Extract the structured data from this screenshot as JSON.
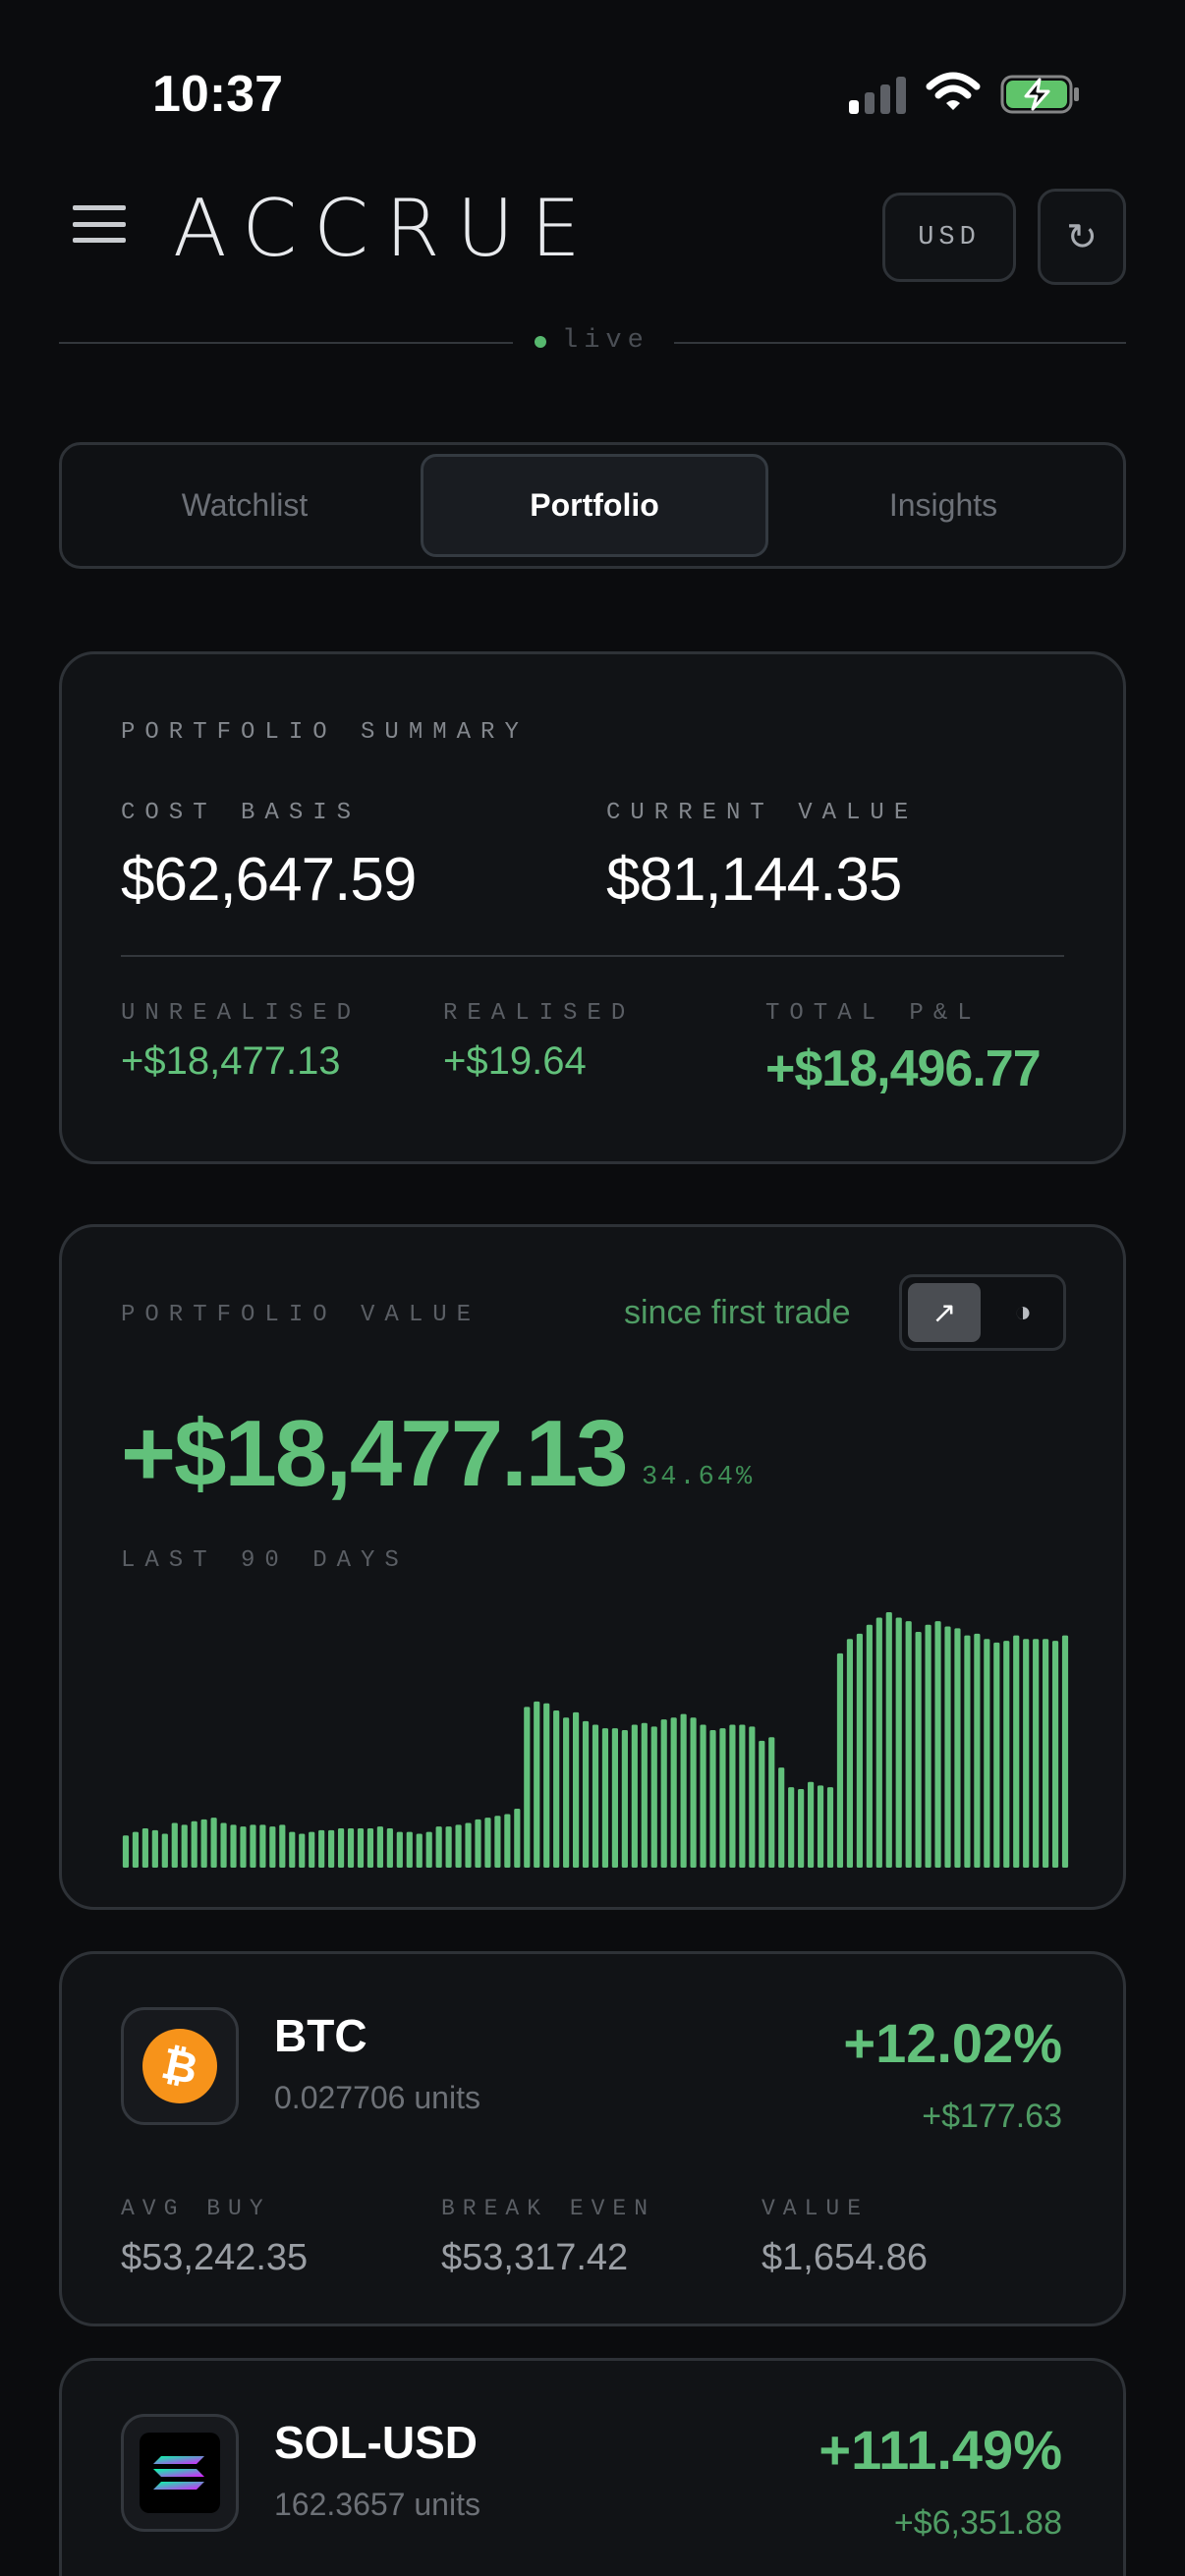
{
  "status_bar": {
    "time": "10:37"
  },
  "header": {
    "brand": "ACCRUE",
    "currency": "USD",
    "refresh_icon": "↻",
    "live_text": "live"
  },
  "tabs": [
    {
      "label": "Watchlist",
      "active": false
    },
    {
      "label": "Portfolio",
      "active": true
    },
    {
      "label": "Insights",
      "active": false
    }
  ],
  "summary": {
    "title": "PORTFOLIO SUMMARY",
    "cost_basis_label": "COST BASIS",
    "cost_basis": "$62,647.59",
    "current_value_label": "CURRENT VALUE",
    "current_value": "$81,144.35",
    "unrealised_label": "UNREALISED",
    "unrealised": "+$18,477.13",
    "realised_label": "REALISED",
    "realised": "+$19.64",
    "total_label": "TOTAL P&L",
    "total": "+$18,496.77"
  },
  "portfolio_value": {
    "title": "PORTFOLIO VALUE",
    "period": "since first trade",
    "toggle_on_icon": "↗",
    "toggle_off_icon": "◑",
    "change": "+$18,477.13",
    "change_pct": "34.64%",
    "range_label": "LAST 90 DAYS"
  },
  "chart_data": {
    "type": "bar",
    "title": "",
    "xlabel": "",
    "ylabel": "",
    "color": "#62c17b",
    "values": [
      18,
      20,
      22,
      21,
      19,
      25,
      24,
      26,
      27,
      28,
      25,
      24,
      23,
      24,
      24,
      23,
      24,
      20,
      19,
      20,
      21,
      21,
      22,
      22,
      22,
      22,
      23,
      22,
      20,
      20,
      19,
      20,
      23,
      23,
      24,
      25,
      27,
      28,
      29,
      30,
      33,
      90,
      93,
      92,
      88,
      84,
      87,
      82,
      80,
      78,
      78,
      77,
      80,
      81,
      79,
      83,
      84,
      86,
      84,
      80,
      77,
      78,
      80,
      80,
      79,
      71,
      73,
      56,
      45,
      44,
      48,
      46,
      45,
      120,
      128,
      131,
      136,
      140,
      143,
      140,
      138,
      132,
      136,
      138,
      135,
      134,
      130,
      131,
      128,
      126,
      127,
      130,
      128,
      128,
      128,
      127,
      130
    ]
  },
  "assets": [
    {
      "symbol": "BTC",
      "units": "0.027706 units",
      "pct": "+12.02%",
      "pnl": "+$177.63",
      "avg_buy_label": "AVG BUY",
      "avg_buy": "$53,242.35",
      "break_even_label": "BREAK EVEN",
      "break_even": "$53,317.42",
      "value_label": "VALUE",
      "value": "$1,654.86",
      "icon_color": "#f7931a"
    },
    {
      "symbol": "SOL-USD",
      "units": "162.3657 units",
      "pct": "+111.49%",
      "pnl": "+$6,351.88"
    }
  ]
}
